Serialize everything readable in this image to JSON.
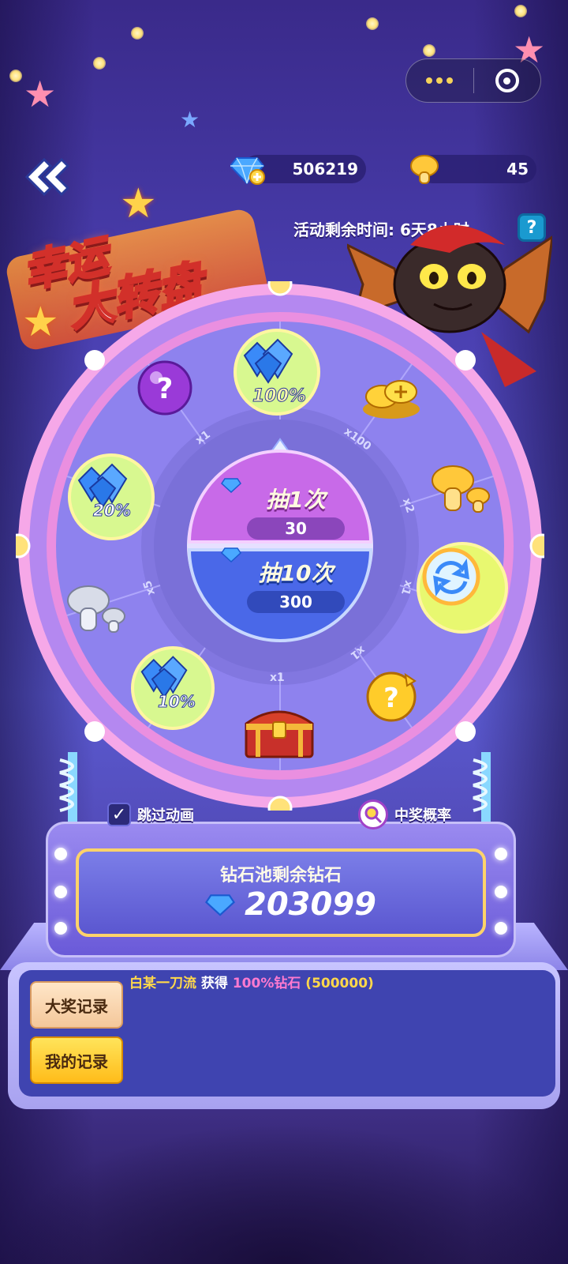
{
  "colors": {
    "accent_gold": "#ffd84a",
    "panel_blue": "#3f44b0",
    "wheel_purple": "#8b7ef0",
    "winner_pink": "#ff7ad0"
  },
  "capsule": {
    "more_icon": "more-dots-icon",
    "close_icon": "target-ring-icon"
  },
  "currency": {
    "diamonds": "506219",
    "mushrooms": "45"
  },
  "timer": {
    "text": "活动剩余时间: 6天8小时"
  },
  "help": {
    "label": "?"
  },
  "title": {
    "line1": "幸运",
    "line2": "大转盘"
  },
  "wheel": {
    "prizes": [
      {
        "id": "mystery-orb",
        "label": "?",
        "icon": "mystery-orb-icon"
      },
      {
        "id": "diamond-100",
        "label": "100%",
        "icon": "diamond-pile-icon"
      },
      {
        "id": "gold-coins",
        "label": "",
        "icon": "gold-coins-icon"
      },
      {
        "id": "gold-mushroom",
        "label": "",
        "icon": "gold-mushroom-icon"
      },
      {
        "id": "refresh-orb",
        "label": "",
        "icon": "refresh-orb-icon"
      },
      {
        "id": "gold-mystery",
        "label": "?",
        "icon": "gold-mystery-icon"
      },
      {
        "id": "treasure-chest",
        "label": "",
        "icon": "treasure-chest-icon"
      },
      {
        "id": "diamond-10",
        "label": "10%",
        "icon": "diamond-pile-icon"
      },
      {
        "id": "silver-mushroom",
        "label": "",
        "icon": "silver-mushroom-icon"
      },
      {
        "id": "diamond-20",
        "label": "20%",
        "icon": "diamond-pile-icon"
      }
    ],
    "multipliers": [
      "x1",
      "x100",
      "x2",
      "x1",
      "x1",
      "x1",
      "x5"
    ]
  },
  "draw": {
    "one": {
      "label": "抽1次",
      "cost": "30"
    },
    "ten": {
      "label": "抽10次",
      "cost": "300"
    }
  },
  "options": {
    "skip_label": "跳过动画",
    "skip_checked": true,
    "odds_label": "中奖概率"
  },
  "pool": {
    "title": "钻石池剩余钻石",
    "value": "203099"
  },
  "records": {
    "grand_label": "大奖记录",
    "mine_label": "我的记录",
    "entries": [
      {
        "who": "白某一刀流",
        "verb": "获得",
        "prize": "100%钻石",
        "amount": "(500000)"
      }
    ]
  }
}
